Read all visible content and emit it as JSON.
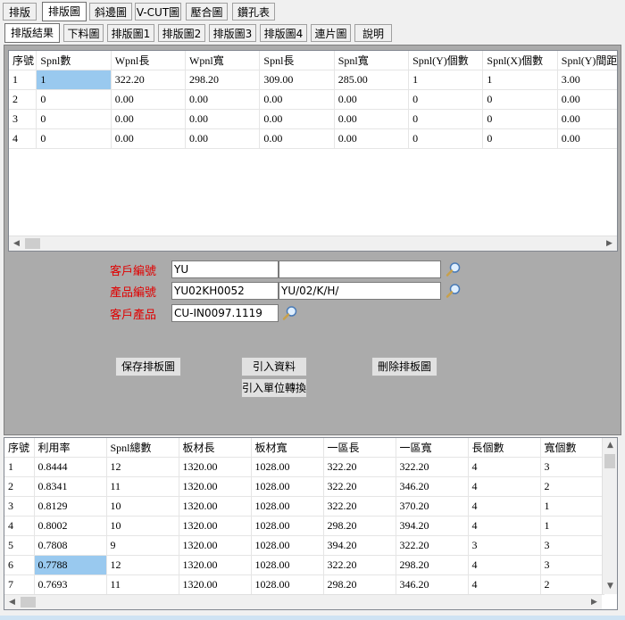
{
  "top_tabs": [
    "排版",
    "排版圖",
    "斜邊圖",
    "V-CUT圖",
    "壓合圖",
    "鑽孔表"
  ],
  "sub_tabs": [
    "排版結果",
    "下料圖",
    "排版圖1",
    "排版圖2",
    "排版圖3",
    "排版圖4",
    "連片圖",
    "說明"
  ],
  "upper_grid": {
    "columns": [
      "序號",
      "Spnl數",
      "Wpnl長",
      "Wpnl寬",
      "Spnl長",
      "Spnl寬",
      "Spnl(Y)個數",
      "Spnl(X)個數",
      "Spnl(Y)間距"
    ],
    "rows": [
      [
        "1",
        "1",
        "322.20",
        "298.20",
        "309.00",
        "285.00",
        "1",
        "1",
        "3.00"
      ],
      [
        "2",
        "0",
        "0.00",
        "0.00",
        "0.00",
        "0.00",
        "0",
        "0",
        "0.00"
      ],
      [
        "3",
        "0",
        "0.00",
        "0.00",
        "0.00",
        "0.00",
        "0",
        "0",
        "0.00"
      ],
      [
        "4",
        "0",
        "0.00",
        "0.00",
        "0.00",
        "0.00",
        "0",
        "0",
        "0.00"
      ]
    ]
  },
  "form": {
    "customer_code_label": "客戶編號",
    "customer_code": "YU",
    "customer_code_extra": "",
    "product_code_label": "產品編號",
    "product_code": "YU02KH0052",
    "product_code_extra": "YU/02/K/H/",
    "customer_product_label": "客戶產品",
    "customer_product": "CU-IN0097.1119"
  },
  "buttons": {
    "save": "保存排板圖",
    "import": "引入資料",
    "delete": "刪除排板圖",
    "import_unit": "引入單位轉換"
  },
  "lower_grid": {
    "columns": [
      "序號",
      "利用率",
      "Spnl總數",
      "板材長",
      "板材寬",
      "一區長",
      "一區寬",
      "長個數",
      "寬個數"
    ],
    "rows": [
      [
        "1",
        "0.8444",
        "12",
        "1320.00",
        "1028.00",
        "322.20",
        "322.20",
        "4",
        "3"
      ],
      [
        "2",
        "0.8341",
        "11",
        "1320.00",
        "1028.00",
        "322.20",
        "346.20",
        "4",
        "2"
      ],
      [
        "3",
        "0.8129",
        "10",
        "1320.00",
        "1028.00",
        "322.20",
        "370.20",
        "4",
        "1"
      ],
      [
        "4",
        "0.8002",
        "10",
        "1320.00",
        "1028.00",
        "298.20",
        "394.20",
        "4",
        "1"
      ],
      [
        "5",
        "0.7808",
        "9",
        "1320.00",
        "1028.00",
        "394.20",
        "322.20",
        "3",
        "3"
      ],
      [
        "6",
        "0.7788",
        "12",
        "1320.00",
        "1028.00",
        "322.20",
        "298.20",
        "4",
        "3"
      ],
      [
        "7",
        "0.7693",
        "11",
        "1320.00",
        "1028.00",
        "298.20",
        "346.20",
        "4",
        "2"
      ]
    ]
  }
}
